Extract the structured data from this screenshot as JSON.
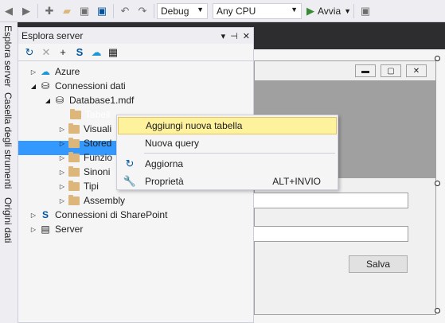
{
  "toolbar": {
    "config": "Debug",
    "platform": "Any CPU",
    "start_label": "Avvia",
    "icons": [
      "back-icon",
      "forward-icon",
      "new-project-icon",
      "open-folder-icon",
      "save-icon",
      "save-all-icon",
      "undo-icon",
      "redo-icon"
    ]
  },
  "vtabs": [
    "Esplora server",
    "Casella degli strumenti",
    "Origini dati"
  ],
  "panel": {
    "title": "Esplora server",
    "title_icons": [
      "▾",
      "⊣",
      "✕"
    ],
    "tools": [
      "↻",
      "✕",
      "+",
      "S",
      "☁",
      "▦"
    ]
  },
  "tree": {
    "azure": "Azure",
    "connessioni": "Connessioni dati",
    "database": "Database1.mdf",
    "tabelle": "Tabell",
    "visual": "Visuali",
    "stored": "Stored",
    "funzioni": "Funzio",
    "sinonimi": "Sinoni",
    "tipi": "Tipi",
    "assembly": "Assembly",
    "sharepoint": "Connessioni di SharePoint",
    "server": "Server"
  },
  "context_menu": {
    "add_table": "Aggiungi nuova tabella",
    "new_query": "Nuova query",
    "refresh": "Aggiorna",
    "properties": "Proprietà",
    "properties_shortcut": "ALT+INVIO"
  },
  "form": {
    "save_label": "Salva",
    "min_glyph": "▬",
    "max_glyph": "▢",
    "close_glyph": "✕"
  },
  "colors": {
    "selection": "#3399ff",
    "menu_highlight": "#fff29d",
    "vs_dark": "#2d2d30"
  }
}
